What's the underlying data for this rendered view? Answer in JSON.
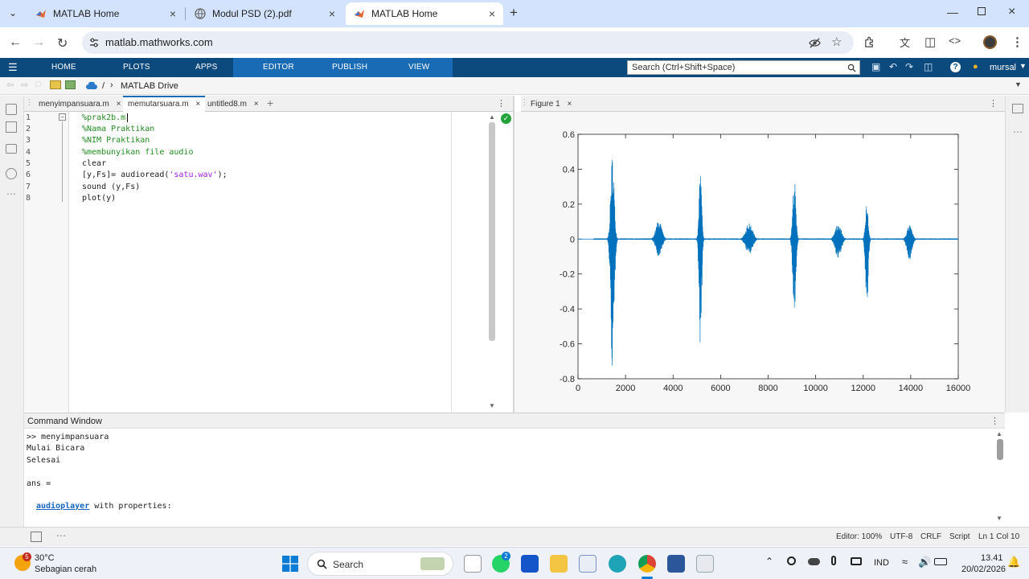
{
  "browser": {
    "tabs": [
      {
        "title": "MATLAB Home",
        "active": false
      },
      {
        "title": "Modul PSD (2).pdf",
        "active": false
      },
      {
        "title": "MATLAB Home",
        "active": true
      }
    ],
    "url": "matlab.mathworks.com"
  },
  "toolstrip": {
    "tabs": [
      "HOME",
      "PLOTS",
      "APPS",
      "EDITOR",
      "PUBLISH",
      "VIEW"
    ],
    "search_placeholder": "Search (Ctrl+Shift+Space)",
    "user": "mursal",
    "path": [
      "/",
      "MATLAB Drive"
    ]
  },
  "editor": {
    "tabs": [
      "menyimpansuara.m",
      "memutarsuara.m",
      "untitled8.m"
    ],
    "active_tab": "memutarsuara.m",
    "line_numbers": [
      "1",
      "2",
      "3",
      "4",
      "5",
      "6",
      "7",
      "8"
    ],
    "lines": [
      "%prak2b.m",
      "%Nama Praktikan",
      "%NIM Praktikan",
      "%membunyikan file audio",
      "clear",
      "[y,Fs]= audioread(",
      "sound (y,Fs)",
      "plot(y)"
    ],
    "line6_string": "'satu.wav'",
    "line6_end": ");"
  },
  "figure": {
    "tab": "Figure 1",
    "chart_data": {
      "type": "line",
      "xlim": [
        0,
        16000
      ],
      "ylim": [
        -0.8,
        0.6
      ],
      "xticks": [
        "0",
        "2000",
        "4000",
        "6000",
        "8000",
        "10000",
        "12000",
        "14000",
        "16000"
      ],
      "yticks": [
        "0.6",
        "0.4",
        "0.2",
        "0",
        "-0.2",
        "-0.4",
        "-0.6",
        "-0.8"
      ],
      "color": "#0072bd",
      "bursts": [
        {
          "center": 1450,
          "width": 300,
          "amp_pos": 0.49,
          "amp_neg": -0.76
        },
        {
          "center": 3400,
          "width": 500,
          "amp_pos": 0.11,
          "amp_neg": -0.11
        },
        {
          "center": 5150,
          "width": 220,
          "amp_pos": 0.42,
          "amp_neg": -0.62
        },
        {
          "center": 7200,
          "width": 600,
          "amp_pos": 0.09,
          "amp_neg": -0.09
        },
        {
          "center": 9100,
          "width": 260,
          "amp_pos": 0.36,
          "amp_neg": -0.45
        },
        {
          "center": 10950,
          "width": 520,
          "amp_pos": 0.09,
          "amp_neg": -0.11
        },
        {
          "center": 12150,
          "width": 240,
          "amp_pos": 0.23,
          "amp_neg": -0.42
        },
        {
          "center": 13950,
          "width": 440,
          "amp_pos": 0.08,
          "amp_neg": -0.12
        }
      ]
    }
  },
  "command_window": {
    "title": "Command Window",
    "lines": [
      ">> menyimpansuara",
      "Mulai Bicara",
      "Selesai",
      "",
      "ans =",
      ""
    ],
    "link": "audioplayer",
    "link_suffix": " with properties:"
  },
  "status": {
    "editor_zoom": "Editor: 100%",
    "encoding": "UTF-8",
    "line_ending": "CRLF",
    "mode": "Script",
    "cursor": "Ln 1 Col 10"
  },
  "taskbar": {
    "weather_temp": "30°C",
    "weather_desc": "Sebagian cerah",
    "search": "Search",
    "lang": "IND",
    "time": "13.41",
    "date": "20/02/2026",
    "badge_weather": "5",
    "badge_whatsapp": "2"
  }
}
